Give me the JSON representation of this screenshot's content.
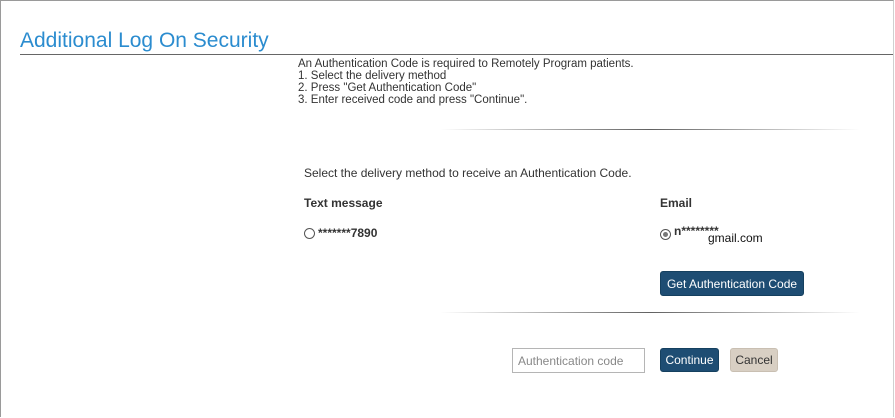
{
  "page": {
    "title": "Additional Log On Security"
  },
  "intro": {
    "line1": "An Authentication Code is required to Remotely Program patients.",
    "line2": "1. Select the delivery method",
    "line3": "2. Press \"Get Authentication Code\"",
    "line4": "3. Enter received code and press \"Continue\"."
  },
  "delivery": {
    "prompt": "Select the delivery method to receive an Authentication Code.",
    "text_message": {
      "heading": "Text message",
      "value": "*******7890",
      "selected": false
    },
    "email": {
      "heading": "Email",
      "masked_value": "n********",
      "overlay_value": "gmail.com",
      "selected": true
    }
  },
  "actions": {
    "get_code_label": "Get Authentication Code",
    "continue_label": "Continue",
    "cancel_label": "Cancel"
  },
  "auth_input": {
    "placeholder": "Authentication code",
    "value": ""
  },
  "colors": {
    "title": "#2b8ccf",
    "primary_button": "#1e4d73",
    "cancel_button": "#d8cfc3"
  }
}
